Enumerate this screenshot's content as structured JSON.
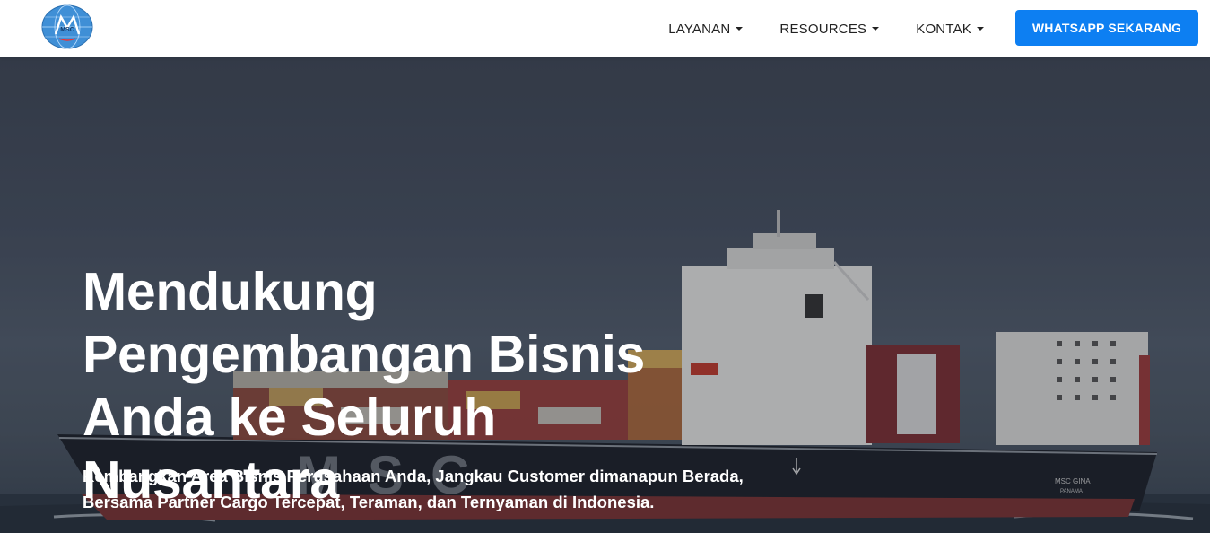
{
  "brand": {
    "logo_icon": "company-globe-logo-icon",
    "logo_text": "MSC"
  },
  "nav": {
    "items": [
      {
        "label": "LAYANAN",
        "icon": "chevron-down-icon"
      },
      {
        "label": "RESOURCES",
        "icon": "chevron-down-icon"
      },
      {
        "label": "KONTAK",
        "icon": "chevron-down-icon"
      }
    ],
    "cta_label": "WHATSAPP SEKARANG",
    "cta_color": "#0d7ff2"
  },
  "hero": {
    "title": "Mendukung Pengembangan Bisnis Anda ke Seluruh Nusantara",
    "subtitle_line1": "Kembangkan Area Bisnis Perusahaan Anda, Jangkau Customer dimanapun Berada,",
    "subtitle_line2": "Bersama Partner Cargo Tercepat, Teraman, dan Ternyaman di Indonesia.",
    "image_hull_text": "MSC",
    "image_bow_text": "MSC GINA",
    "image_bow_subtext": "PANAMA"
  }
}
